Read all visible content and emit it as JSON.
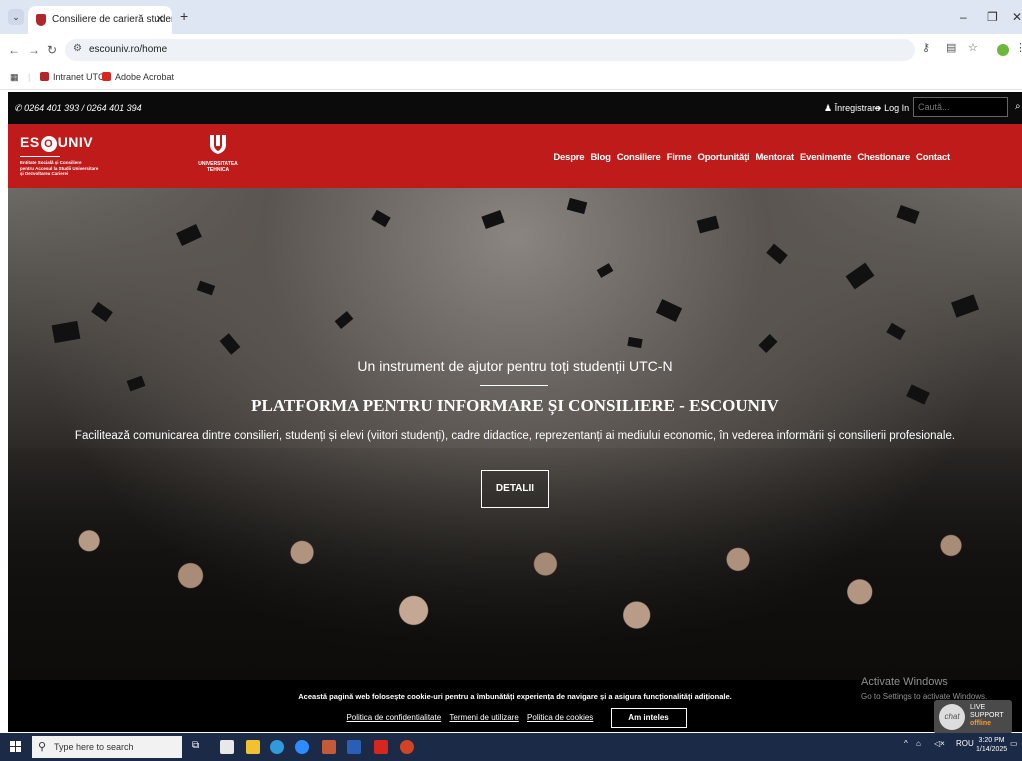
{
  "browser": {
    "tab_title": "Consiliere de carieră studenți U",
    "url": "escouniv.ro/home",
    "bookmarks": [
      {
        "label": "Intranet UTCN",
        "color": "#b0262a"
      },
      {
        "label": "Adobe Acrobat",
        "color": "#d7261e"
      }
    ]
  },
  "topbar": {
    "phone": "0264 401 393 / 0264 401 394",
    "register": "Înregistrare",
    "login": "Log In",
    "search_placeholder": "Caută..."
  },
  "header": {
    "logo_brand_left": "ES",
    "logo_brand_o": "O",
    "logo_brand_right": "UNIV",
    "logo_subtitle_1": "Entitate Socială și Consiliere",
    "logo_subtitle_2": "pentru Accesul la Studii Universitare",
    "logo_subtitle_3": "și Dezvoltarea Carierei",
    "utcn_line1": "UNIVERSITATEA",
    "utcn_line2": "TEHNICA",
    "menu": [
      "Despre",
      "Blog",
      "Consiliere",
      "Firme",
      "Oportunități",
      "Mentorat",
      "Evenimente",
      "Chestionare",
      "Contact"
    ]
  },
  "hero": {
    "tagline": "Un instrument de ajutor pentru toți studenții UTC-N",
    "title": "PLATFORMA PENTRU INFORMARE ȘI CONSILIERE - ESCOUNIV",
    "description": "Facilitează comunicarea dintre consilieri, studenți și elevi (viitori studenți), cadre didactice, reprezentanți ai mediului economic, în vederea informării și consilierii profesionale.",
    "button": "DETALII"
  },
  "cookie": {
    "message": "Această pagină web folosește cookie-uri pentru a îmbunătăți experiența de navigare și a asigura funcționalități adiționale.",
    "privacy": "Politica de confidentialitate",
    "terms": "Termeni de utilizare",
    "cookies_policy": "Politica de cookies",
    "accept": "Am inteles"
  },
  "activate_windows": {
    "title": "Activate Windows",
    "subtitle": "Go to Settings to activate Windows."
  },
  "live_support": {
    "bubble": "chat",
    "line1": "LIVE",
    "line2": "SUPPORT",
    "status": "offline"
  },
  "taskbar": {
    "search_placeholder": "Type here to search",
    "language": "ROU",
    "time": "3:20 PM",
    "date": "1/14/2025"
  }
}
